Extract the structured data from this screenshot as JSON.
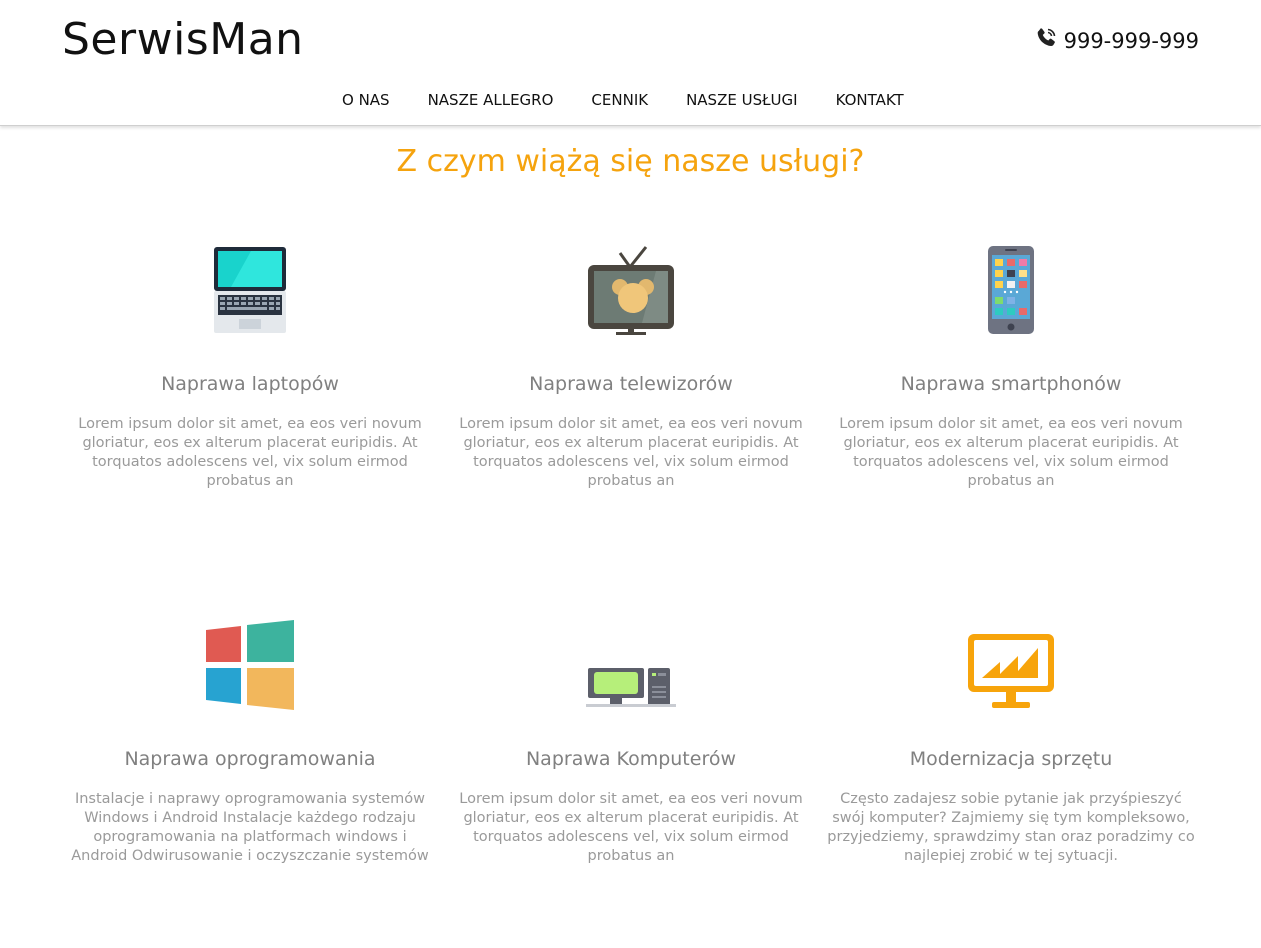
{
  "header": {
    "logo": "SerwisMan",
    "phone_icon": "phone-icon",
    "phone": "999-999-999"
  },
  "nav": {
    "items": [
      "O NAS",
      "NASZE ALLEGRO",
      "CENNIK",
      "NASZE USŁUGI",
      "KONTAKT"
    ]
  },
  "section": {
    "title": "Z czym wiążą się nasze usługi?"
  },
  "services": [
    {
      "icon": "laptop-icon",
      "title": "Naprawa laptopów",
      "description": "Lorem ipsum dolor sit amet, ea eos veri novum gloriatur, eos ex alterum placerat euripidis. At torquatos adolescens vel, vix solum eirmod probatus an"
    },
    {
      "icon": "tv-icon",
      "title": "Naprawa telewizorów",
      "description": "Lorem ipsum dolor sit amet, ea eos veri novum gloriatur, eos ex alterum placerat euripidis. At torquatos adolescens vel, vix solum eirmod probatus an"
    },
    {
      "icon": "smartphone-icon",
      "title": "Naprawa smartphonów",
      "description": "Lorem ipsum dolor sit amet, ea eos veri novum gloriatur, eos ex alterum placerat euripidis. At torquatos adolescens vel, vix solum eirmod probatus an"
    },
    {
      "icon": "windows-icon",
      "title": "Naprawa oprogramowania",
      "description": "Instalacje i naprawy oprogramowania systemów Windows i Android Instalacje każdego rodzaju oprogramowania na platformach windows i Android Odwirusowanie i oczyszczanie systemów"
    },
    {
      "icon": "desktop-computer-icon",
      "title": "Naprawa Komputerów",
      "description": "Lorem ipsum dolor sit amet, ea eos veri novum gloriatur, eos ex alterum placerat euripidis. At torquatos adolescens vel, vix solum eirmod probatus an"
    },
    {
      "icon": "chart-monitor-icon",
      "title": "Modernizacja sprzętu",
      "description": "Często zadajesz sobie pytanie jak przyśpieszyć swój komputer? Zajmiemy się tym kompleksowo, przyjedziemy, sprawdzimy stan oraz poradzimy co najlepiej zrobić w tej sytuacji."
    }
  ],
  "colors": {
    "accent": "#f5a30e",
    "text_muted": "#9a9a9a"
  }
}
